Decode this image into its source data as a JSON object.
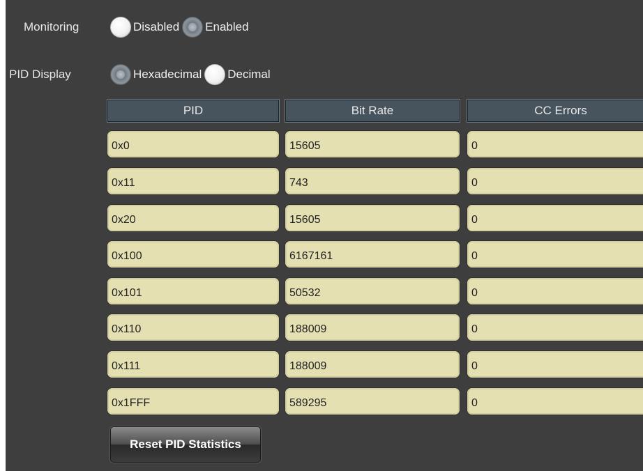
{
  "monitoring": {
    "label": "Monitoring",
    "options": [
      {
        "label": "Disabled",
        "selected": false
      },
      {
        "label": "Enabled",
        "selected": true
      }
    ]
  },
  "pid_display": {
    "label": "PID Display",
    "options": [
      {
        "label": "Hexadecimal",
        "selected": true
      },
      {
        "label": "Decimal",
        "selected": false
      }
    ]
  },
  "table": {
    "headers": [
      "PID",
      "Bit Rate",
      "CC Errors"
    ],
    "rows": [
      {
        "pid": "0x0",
        "bitrate": "15605",
        "cc_errors": "0"
      },
      {
        "pid": "0x11",
        "bitrate": "743",
        "cc_errors": "0"
      },
      {
        "pid": "0x20",
        "bitrate": "15605",
        "cc_errors": "0"
      },
      {
        "pid": "0x100",
        "bitrate": "6167161",
        "cc_errors": "0"
      },
      {
        "pid": "0x101",
        "bitrate": "50532",
        "cc_errors": "0"
      },
      {
        "pid": "0x110",
        "bitrate": "188009",
        "cc_errors": "0"
      },
      {
        "pid": "0x111",
        "bitrate": "188009",
        "cc_errors": "0"
      },
      {
        "pid": "0x1FFF",
        "bitrate": "589295",
        "cc_errors": "0"
      }
    ]
  },
  "reset_button": {
    "label": "Reset PID Statistics"
  },
  "colors": {
    "panel_background": "#3e3e3e",
    "header_background": "#47535d",
    "cell_background": "#e4e0b2"
  }
}
